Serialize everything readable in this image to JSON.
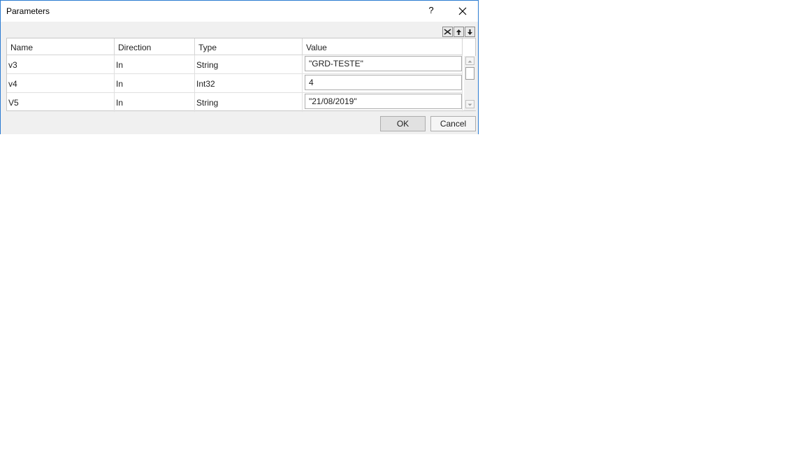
{
  "window": {
    "title": "Parameters",
    "help_label": "?"
  },
  "toolbar": {
    "icons": [
      "delete-icon",
      "arrow-up-icon",
      "arrow-down-icon"
    ]
  },
  "grid": {
    "columns": [
      "Name",
      "Direction",
      "Type",
      "Value"
    ],
    "rows": [
      {
        "name": "v3",
        "direction": "In",
        "type": "String",
        "value": "\"GRD-TESTE\""
      },
      {
        "name": "v4",
        "direction": "In",
        "type": "Int32",
        "value": "4"
      },
      {
        "name": "V5",
        "direction": "In",
        "type": "String",
        "value": "\"21/08/2019\""
      }
    ]
  },
  "buttons": {
    "ok": "OK",
    "cancel": "Cancel"
  },
  "colors": {
    "border_accent": "#2b7bd1",
    "dialog_bg": "#f0f0f0"
  }
}
